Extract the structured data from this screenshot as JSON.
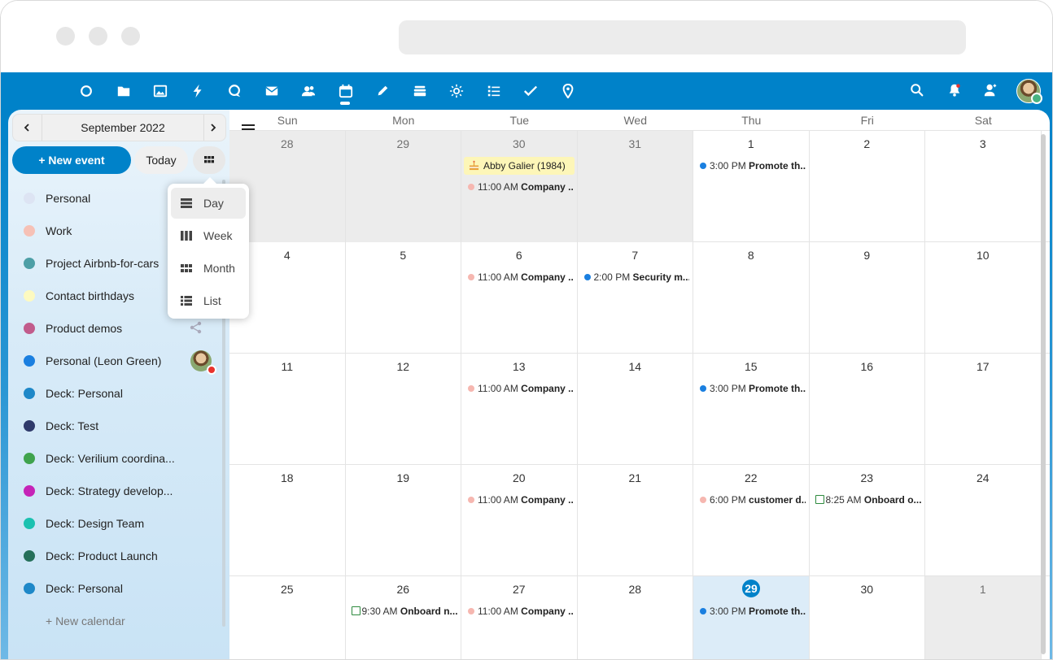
{
  "browser": {
    "address_bar": ""
  },
  "topbar": {
    "apps": [
      {
        "name": "dashboard-icon"
      },
      {
        "name": "files-icon"
      },
      {
        "name": "photos-icon"
      },
      {
        "name": "activity-icon"
      },
      {
        "name": "talk-icon"
      },
      {
        "name": "mail-icon"
      },
      {
        "name": "contacts-icon"
      },
      {
        "name": "calendar-icon"
      },
      {
        "name": "notes-icon"
      },
      {
        "name": "deck-icon"
      },
      {
        "name": "weather-icon"
      },
      {
        "name": "tasks-list-icon"
      },
      {
        "name": "tasks-check-icon"
      },
      {
        "name": "maps-icon"
      }
    ],
    "right": [
      "search-icon",
      "notifications-icon",
      "contacts-menu-icon",
      "user-avatar"
    ],
    "accent": "#0082c9"
  },
  "sidebar": {
    "month_label": "September 2022",
    "prev": "‹",
    "next": "›",
    "new_event": "+ New event",
    "today": "Today",
    "calendars": [
      {
        "label": "Personal",
        "color": "#dde4f3"
      },
      {
        "label": "Work",
        "color": "#f6c1b6"
      },
      {
        "label": "Project Airbnb-for-cars",
        "color": "#4d9fa6"
      },
      {
        "label": "Contact birthdays",
        "color": "#fdfac0"
      },
      {
        "label": "Product demos",
        "color": "#c15c8c"
      },
      {
        "label": "Personal (Leon Green)",
        "color": "#1a7fe0"
      },
      {
        "label": "Deck: Personal",
        "color": "#1e88c8"
      },
      {
        "label": "Deck: Test",
        "color": "#2f3a6b"
      },
      {
        "label": "Deck: Verilium coordina...",
        "color": "#3fa34d"
      },
      {
        "label": "Deck: Strategy develop...",
        "color": "#c524b7"
      },
      {
        "label": "Deck: Design Team",
        "color": "#1bc1b0"
      },
      {
        "label": "Deck: Product Launch",
        "color": "#26705a"
      },
      {
        "label": "Deck: Personal",
        "color": "#1e88c8"
      }
    ],
    "new_calendar": "+ New calendar"
  },
  "view_menu": {
    "items": [
      {
        "label": "Day",
        "active": true
      },
      {
        "label": "Week",
        "active": false
      },
      {
        "label": "Month",
        "active": false
      },
      {
        "label": "List",
        "active": false
      }
    ]
  },
  "grid": {
    "days_of_week": [
      "Sun",
      "Mon",
      "Tue",
      "Wed",
      "Thu",
      "Fri",
      "Sat"
    ],
    "weeks": [
      [
        {
          "day": "28",
          "out": true,
          "events": []
        },
        {
          "day": "29",
          "out": true,
          "events": []
        },
        {
          "day": "30",
          "out": true,
          "events": [
            {
              "kind": "birthday",
              "title": "Abby Galier (1984)"
            },
            {
              "kind": "dot",
              "color": "#f6b7b0",
              "time": "11:00 AM",
              "title": "Company ..."
            }
          ]
        },
        {
          "day": "31",
          "out": true,
          "events": []
        },
        {
          "day": "1",
          "events": [
            {
              "kind": "dot",
              "color": "#1a7fe0",
              "time": "3:00 PM",
              "title": "Promote th..."
            }
          ]
        },
        {
          "day": "2",
          "events": []
        },
        {
          "day": "3",
          "events": []
        }
      ],
      [
        {
          "day": "4",
          "events": []
        },
        {
          "day": "5",
          "events": []
        },
        {
          "day": "6",
          "events": [
            {
              "kind": "dot",
              "color": "#f6b7b0",
              "time": "11:00 AM",
              "title": "Company ..."
            }
          ]
        },
        {
          "day": "7",
          "events": [
            {
              "kind": "dot",
              "color": "#1a7fe0",
              "time": "2:00 PM",
              "title": "Security m..."
            }
          ]
        },
        {
          "day": "8",
          "events": []
        },
        {
          "day": "9",
          "events": []
        },
        {
          "day": "10",
          "events": []
        }
      ],
      [
        {
          "day": "11",
          "events": []
        },
        {
          "day": "12",
          "events": []
        },
        {
          "day": "13",
          "events": [
            {
              "kind": "dot",
              "color": "#f6b7b0",
              "time": "11:00 AM",
              "title": "Company ..."
            }
          ]
        },
        {
          "day": "14",
          "events": []
        },
        {
          "day": "15",
          "events": [
            {
              "kind": "dot",
              "color": "#1a7fe0",
              "time": "3:00 PM",
              "title": "Promote th..."
            }
          ]
        },
        {
          "day": "16",
          "events": []
        },
        {
          "day": "17",
          "events": []
        }
      ],
      [
        {
          "day": "18",
          "events": []
        },
        {
          "day": "19",
          "events": []
        },
        {
          "day": "20",
          "events": [
            {
              "kind": "dot",
              "color": "#f6b7b0",
              "time": "11:00 AM",
              "title": "Company ..."
            }
          ]
        },
        {
          "day": "21",
          "events": []
        },
        {
          "day": "22",
          "events": [
            {
              "kind": "dot",
              "color": "#f6b7b0",
              "time": "6:00 PM",
              "title": "customer d..."
            }
          ]
        },
        {
          "day": "23",
          "events": [
            {
              "kind": "task",
              "time": "8:25 AM",
              "title": "Onboard o..."
            }
          ]
        },
        {
          "day": "24",
          "events": []
        }
      ],
      [
        {
          "day": "25",
          "events": []
        },
        {
          "day": "26",
          "events": [
            {
              "kind": "task",
              "time": "9:30 AM",
              "title": "Onboard n..."
            }
          ]
        },
        {
          "day": "27",
          "events": [
            {
              "kind": "dot",
              "color": "#f6b7b0",
              "time": "11:00 AM",
              "title": "Company ..."
            }
          ]
        },
        {
          "day": "28",
          "events": []
        },
        {
          "day": "29",
          "today": true,
          "events": [
            {
              "kind": "dot",
              "color": "#1a7fe0",
              "time": "3:00 PM",
              "title": "Promote th..."
            }
          ]
        },
        {
          "day": "30",
          "events": []
        },
        {
          "day": "1",
          "out": true,
          "events": []
        }
      ]
    ]
  }
}
